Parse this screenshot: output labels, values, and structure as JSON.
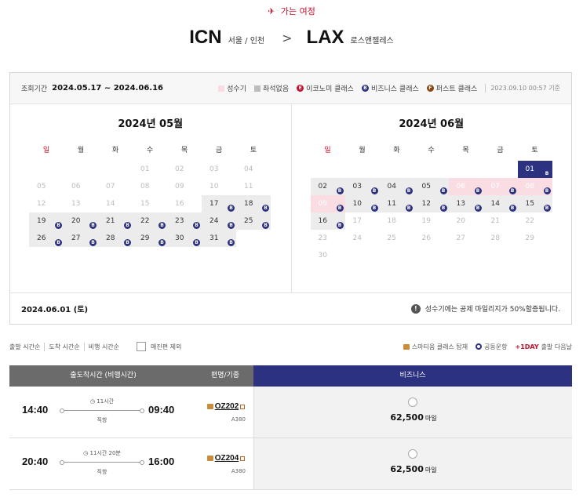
{
  "header": {
    "trip_label": "가는 여정",
    "origin_code": "ICN",
    "origin_city": "서울 / 인천",
    "dest_code": "LAX",
    "dest_city": "로스앤젤레스"
  },
  "calendar": {
    "period_label": "조회기간",
    "period": "2024.05.17 ~ 2024.06.16",
    "legend": {
      "peak": "성수기",
      "no_seat": "좌석없음",
      "economy": "이코노미 클래스",
      "business": "비즈니스 클래스",
      "first": "퍼스트 클래스",
      "timestamp": "2023.09.10 00:57 기준",
      "economy_letter": "E",
      "business_letter": "B",
      "first_letter": "F"
    },
    "colors": {
      "peak": "#f9dde3",
      "no_seat": "#bdbdbd",
      "economy": "#c8102e",
      "business": "#2c3280",
      "first": "#8b4513"
    },
    "weekdays": [
      "일",
      "월",
      "화",
      "수",
      "목",
      "금",
      "토"
    ],
    "months": [
      {
        "title": "2024년 05월",
        "weeks": [
          [
            {
              "d": ""
            },
            {
              "d": ""
            },
            {
              "d": ""
            },
            {
              "d": "01"
            },
            {
              "d": "02"
            },
            {
              "d": "03"
            },
            {
              "d": "04"
            }
          ],
          [
            {
              "d": "05"
            },
            {
              "d": "06"
            },
            {
              "d": "07"
            },
            {
              "d": "08"
            },
            {
              "d": "09"
            },
            {
              "d": "10"
            },
            {
              "d": "11"
            }
          ],
          [
            {
              "d": "12"
            },
            {
              "d": "13"
            },
            {
              "d": "14"
            },
            {
              "d": "15"
            },
            {
              "d": "16"
            },
            {
              "d": "17",
              "s": "avail"
            },
            {
              "d": "18",
              "s": "avail"
            }
          ],
          [
            {
              "d": "19",
              "s": "avail"
            },
            {
              "d": "20",
              "s": "avail"
            },
            {
              "d": "21",
              "s": "avail"
            },
            {
              "d": "22",
              "s": "avail"
            },
            {
              "d": "23",
              "s": "avail"
            },
            {
              "d": "24",
              "s": "avail"
            },
            {
              "d": "25",
              "s": "avail"
            }
          ],
          [
            {
              "d": "26",
              "s": "avail"
            },
            {
              "d": "27",
              "s": "avail"
            },
            {
              "d": "28",
              "s": "avail"
            },
            {
              "d": "29",
              "s": "avail"
            },
            {
              "d": "30",
              "s": "avail"
            },
            {
              "d": "31",
              "s": "avail"
            },
            {
              "d": ""
            }
          ]
        ]
      },
      {
        "title": "2024년 06월",
        "weeks": [
          [
            {
              "d": ""
            },
            {
              "d": ""
            },
            {
              "d": ""
            },
            {
              "d": ""
            },
            {
              "d": ""
            },
            {
              "d": ""
            },
            {
              "d": "01",
              "s": "sel"
            }
          ],
          [
            {
              "d": "02",
              "s": "avail"
            },
            {
              "d": "03",
              "s": "avail"
            },
            {
              "d": "04",
              "s": "avail"
            },
            {
              "d": "05",
              "s": "avail"
            },
            {
              "d": "06",
              "s": "peak"
            },
            {
              "d": "07",
              "s": "peak"
            },
            {
              "d": "08",
              "s": "peak"
            }
          ],
          [
            {
              "d": "09",
              "s": "peak"
            },
            {
              "d": "10",
              "s": "avail"
            },
            {
              "d": "11",
              "s": "avail"
            },
            {
              "d": "12",
              "s": "avail"
            },
            {
              "d": "13",
              "s": "avail"
            },
            {
              "d": "14",
              "s": "avail"
            },
            {
              "d": "15",
              "s": "avail"
            }
          ],
          [
            {
              "d": "16",
              "s": "avail"
            },
            {
              "d": "17"
            },
            {
              "d": "18"
            },
            {
              "d": "19"
            },
            {
              "d": "20"
            },
            {
              "d": "21"
            },
            {
              "d": "22"
            }
          ],
          [
            {
              "d": "23"
            },
            {
              "d": "24"
            },
            {
              "d": "25"
            },
            {
              "d": "26"
            },
            {
              "d": "27"
            },
            {
              "d": "28"
            },
            {
              "d": "29"
            }
          ],
          [
            {
              "d": "30"
            },
            {
              "d": ""
            },
            {
              "d": ""
            },
            {
              "d": ""
            },
            {
              "d": ""
            },
            {
              "d": ""
            },
            {
              "d": ""
            }
          ]
        ]
      }
    ],
    "selected_date": "2024.06.01 (토)",
    "notice": "성수기에는 공제 마일리지가 50%할증됩니다.",
    "notice_icon": "!"
  },
  "filters": {
    "sort_options": [
      "출발 시간순",
      "도착 시간순",
      "비행 시간순"
    ],
    "exclude_soldout": "매진편 제외",
    "marks": {
      "smartium": "스마티움 클래스 탑재",
      "codeshare": "공동운항",
      "plus1": "+1DAY",
      "plus1_desc": "출발 다음날"
    }
  },
  "results": {
    "headers": {
      "time": "출도착시간 (비행시간)",
      "flight": "편명/기종",
      "business": "비즈니스"
    },
    "flights": [
      {
        "dep": "14:40",
        "arr": "09:40",
        "duration": "11시간",
        "stops": "직항",
        "flight_no": "OZ202",
        "aircraft": "A380",
        "miles": "62,500",
        "unit": "마일"
      },
      {
        "dep": "20:40",
        "arr": "16:00",
        "duration": "11시간 20분",
        "stops": "직항",
        "flight_no": "OZ204",
        "aircraft": "A380",
        "miles": "62,500",
        "unit": "마일"
      }
    ]
  }
}
